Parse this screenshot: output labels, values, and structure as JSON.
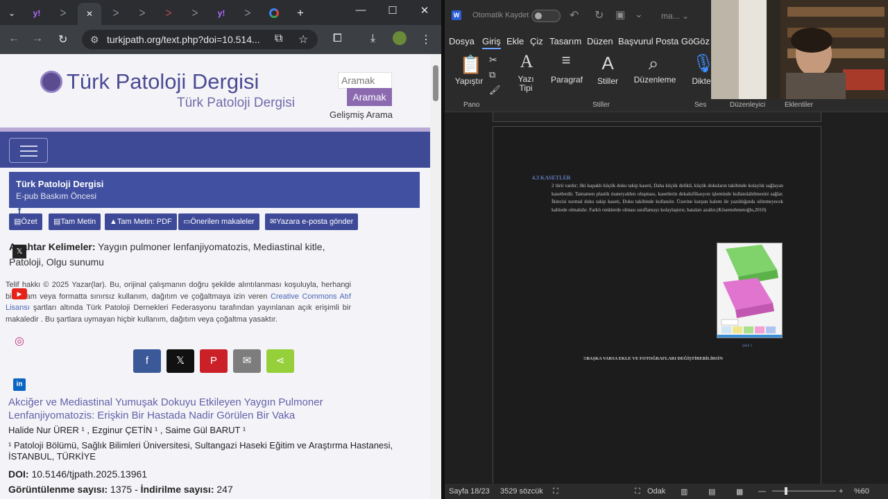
{
  "browser": {
    "tabs": [
      "ᐳ",
      "ᐳ",
      "ᐳ",
      "ᐳ",
      "ᐳ",
      "ᐳ",
      "ᐳ",
      "ᐳ"
    ],
    "tab_yahoo": "y!",
    "tab_close": "✕",
    "new_tab": "+",
    "url": "turkjpath.org/text.php?doi=10.514...",
    "window": {
      "minimize": "—",
      "maximize": "☐",
      "close": "✕"
    }
  },
  "site": {
    "title": "Türk Patoloji Dergisi",
    "subtitle": "Türk Patoloji Dergisi",
    "search_placeholder": "Aramak",
    "search_button": "Aramak",
    "advanced_search": "Gelişmiş Arama"
  },
  "article_header": {
    "journal": "Türk Patoloji Dergisi",
    "status": "E-pub Baskım Öncesi"
  },
  "page_buttons": [
    "Özet",
    "Tam Metin",
    "Tam Metin: PDF",
    "Önerilen makaleler",
    "Yazara e-posta gönder"
  ],
  "keywords": {
    "label": "Anahtar Kelimeler:",
    "text": "Yaygın pulmoner lenfanjiyomatozis, Mediastinal kitle, Patoloji, Olgu sunumu"
  },
  "copyright": {
    "before": "Telif hakkı © 2025 Yazar(lar). Bu, orijinal çalışmanın doğru şekilde alıntılanması koşuluyla, herhangi bir ortam veya formatta sınırsız kullanım, dağıtım ve çoğaltmaya izin veren ",
    "link": "Creative Commons Atıf Lisansı",
    "after": " şartları altında Türk Patoloji Dernekleri Federasyonu tarafından yayınlanan açık erişimli bir makaledir . Bu şartlara uymayan hiçbir kullanım, dağıtım veya çoğaltma yasaktır."
  },
  "share": {
    "facebook": "f",
    "x": "𝕏",
    "pinterest": "P",
    "email": "✉",
    "sharethis": "⋖"
  },
  "social": {
    "facebook": "f",
    "x": "𝕏",
    "youtube": "▶",
    "instagram": "◎",
    "linkedin": "in"
  },
  "article": {
    "title": "Akciğer ve Mediastinal Yumuşak Dokuyu Etkileyen Yaygın Pulmoner Lenfanjiyomatozis: Erişkin Bir Hastada Nadir Görülen Bir Vaka",
    "authors": "Halide Nur ÜRER ¹ , Ezginur ÇETİN ¹ , Saime Gül BARUT ¹",
    "affiliation": "¹ Patoloji Bölümü, Sağlık Bilimleri Üniversitesi, Sultangazi Haseki Eğitim ve Araştırma Hastanesi, İSTANBUL, TÜRKİYE",
    "doi_label": "DOI:",
    "doi": "10.5146/tjpath.2025.13961",
    "views_label": "Görüntülenme sayısı:",
    "views": "1375",
    "downloads_label": "İndirilme sayısı:",
    "downloads": "247"
  },
  "word": {
    "autosave": "Otomatik Kaydet",
    "docname": "ma...",
    "menu": [
      "Dosya",
      "Giriş",
      "Ekle",
      "Çiz",
      "Tasarım",
      "Düzen",
      "Başvurul",
      "Posta Gö",
      "Göz"
    ],
    "ribbon": {
      "paste": "Yapıştır",
      "font": "Yazı Tipi",
      "paragraph": "Paragraf",
      "styles": "Stiller",
      "editing": "Düzenleme",
      "dictate": "Dikte",
      "groups": [
        "Pano",
        "Stiller",
        "Ses",
        "Düzenleyici",
        "Eklentiler"
      ]
    },
    "doc": {
      "heading": "4.3    KASETLER",
      "body": "2 türü vardır; ilki kapaklı küçük doku takip kaseti, Daha küçük delikli, küçük dokuların takibinde kolaylık sağlayan kasetlerdir. Tamamen plastik materyalden oluşması, kasetlerin dekalsifikasyon işleminde kullanılabilmesini sağlar. İkincisi normal doku takip kaseti, Doku takibinde kullanılır. Üzerine kurşun kalem ile yazıldığında silinmeyecek kalitede olmalıdır. Farklı renklerde olması sınıflamayı kolaylaştırır, hataları azaltır.(Kösemehmetoğlu,2010)",
      "figure_caption": "Şekil 3",
      "note": "!!BAŞKA VARSA EKLE VE FOTOĞRAFLARI DEĞİŞTİREBİLİRSİN"
    },
    "status": {
      "page": "Sayfa 18/23",
      "words": "3529 sözcük",
      "focus": "Odak",
      "zoom": "%60"
    }
  }
}
